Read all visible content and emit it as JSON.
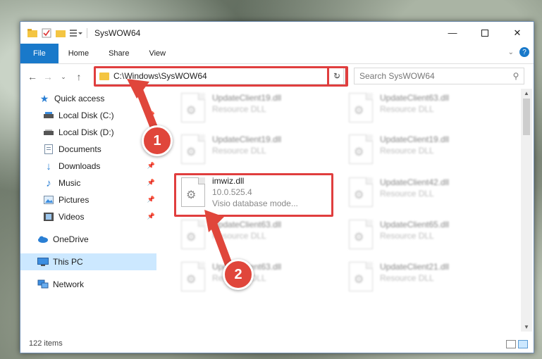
{
  "window": {
    "title": "SysWOW64"
  },
  "ribbon": {
    "tabs": [
      "File",
      "Home",
      "Share",
      "View"
    ]
  },
  "address": {
    "path": "C:\\Windows\\SysWOW64"
  },
  "search": {
    "placeholder": "Search SysWOW64"
  },
  "sidebar": {
    "items": [
      {
        "label": "Quick access",
        "icon": "star-icon"
      },
      {
        "label": "Local Disk (C:)",
        "icon": "drive-icon"
      },
      {
        "label": "Local Disk (D:)",
        "icon": "drive-icon"
      },
      {
        "label": "Documents",
        "icon": "documents-icon"
      },
      {
        "label": "Downloads",
        "icon": "downloads-icon"
      },
      {
        "label": "Music",
        "icon": "music-icon"
      },
      {
        "label": "Pictures",
        "icon": "pictures-icon"
      },
      {
        "label": "Videos",
        "icon": "videos-icon"
      },
      {
        "label": "OneDrive",
        "icon": "cloud-icon"
      },
      {
        "label": "This PC",
        "icon": "computer-icon"
      },
      {
        "label": "Network",
        "icon": "network-icon"
      }
    ]
  },
  "files": [
    {
      "name": "UpdateClient19.dll",
      "sub": "Resource DLL"
    },
    {
      "name": "UpdateClient63.dll",
      "sub": "Resource DLL"
    },
    {
      "name": "UpdateClient19.dll",
      "sub": "Resource DLL"
    },
    {
      "name": "UpdateClient19.dll",
      "sub": "Resource DLL"
    },
    {
      "name": "imwiz.dll",
      "version": "10.0.525.4",
      "desc": "Visio database mode..."
    },
    {
      "name": "UpdateClient42.dll",
      "sub": "Resource DLL"
    },
    {
      "name": "UpdateClient63.dll",
      "sub": "Resource DLL"
    },
    {
      "name": "UpdateClient65.dll",
      "sub": "Resource DLL"
    },
    {
      "name": "UpdateClient63.dll",
      "sub": "Resource DLL"
    },
    {
      "name": "UpdateClient21.dll",
      "sub": "Resource DLL"
    }
  ],
  "status": {
    "count": "122 items"
  },
  "callouts": [
    "1",
    "2"
  ],
  "colors": {
    "accent": "#1979ca",
    "highlight": "#e03e3e",
    "selected": "#cce8ff"
  }
}
